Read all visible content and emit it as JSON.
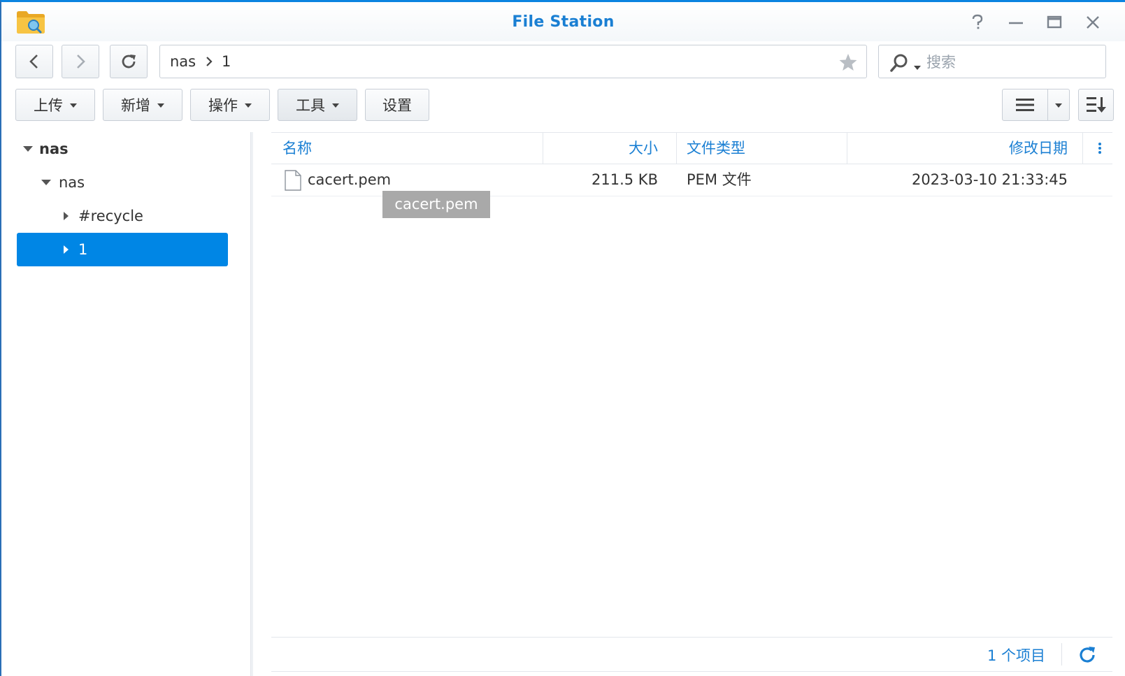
{
  "window": {
    "title": "File Station",
    "controls": [
      "help-icon",
      "minimize-icon",
      "maximize-icon",
      "close-icon"
    ],
    "accent_color": "#0b84e0"
  },
  "nav": {
    "path": [
      "nas",
      "1"
    ],
    "search_placeholder": "搜索"
  },
  "toolbar": {
    "upload": "上传",
    "create": "新增",
    "action": "操作",
    "tools": "工具",
    "settings": "设置"
  },
  "tree": {
    "items": [
      {
        "label": "nas",
        "expanded": true
      },
      {
        "label": "nas",
        "expanded": true
      },
      {
        "label": "#recycle",
        "expanded": false
      },
      {
        "label": "1",
        "expanded": false,
        "selected": true
      }
    ],
    "selected_color": "#0086e5"
  },
  "grid": {
    "columns": [
      "名称",
      "大小",
      "文件类型",
      "修改日期"
    ],
    "rows": [
      {
        "name": "cacert.pem",
        "size": "211.5 KB",
        "type": "PEM 文件",
        "modified": "2023-03-10 21:33:45"
      }
    ],
    "tooltip": "cacert.pem",
    "header_color": "#1a7fd3"
  },
  "status": {
    "count": "1 个项目"
  }
}
